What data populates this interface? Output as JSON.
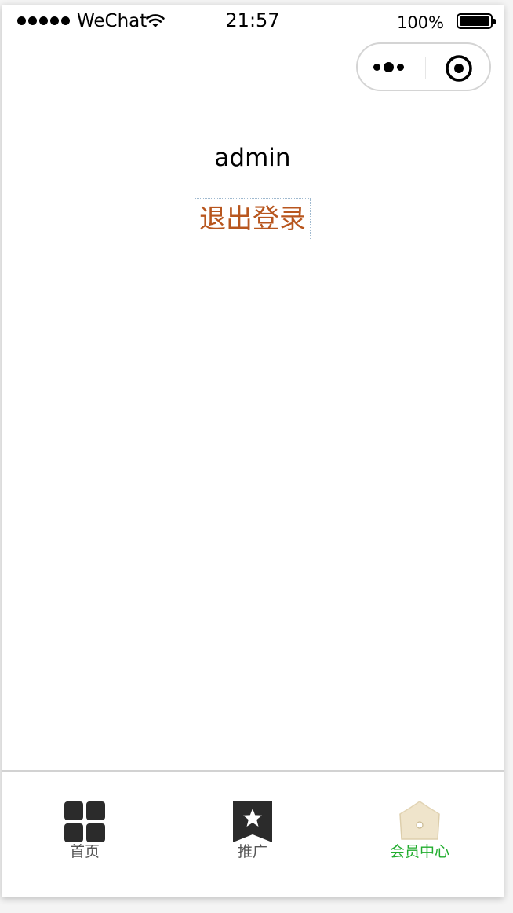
{
  "status_bar": {
    "carrier": "WeChat",
    "time": "21:57",
    "battery_percent": "100%"
  },
  "capsule": {
    "more_icon": "more-dots-icon",
    "close_icon": "target-icon"
  },
  "user": {
    "name": "admin"
  },
  "logout_label": "退出登录",
  "tabbar": {
    "items": [
      {
        "label": "首页",
        "icon": "grid-icon",
        "active": false
      },
      {
        "label": "推广",
        "icon": "bookmark-star-icon",
        "active": false
      },
      {
        "label": "会员中心",
        "icon": "crown-icon",
        "active": true
      }
    ]
  },
  "colors": {
    "active_tab": "#21ad2e",
    "logout_text": "#b8561e",
    "inactive_tab": "#555555"
  }
}
